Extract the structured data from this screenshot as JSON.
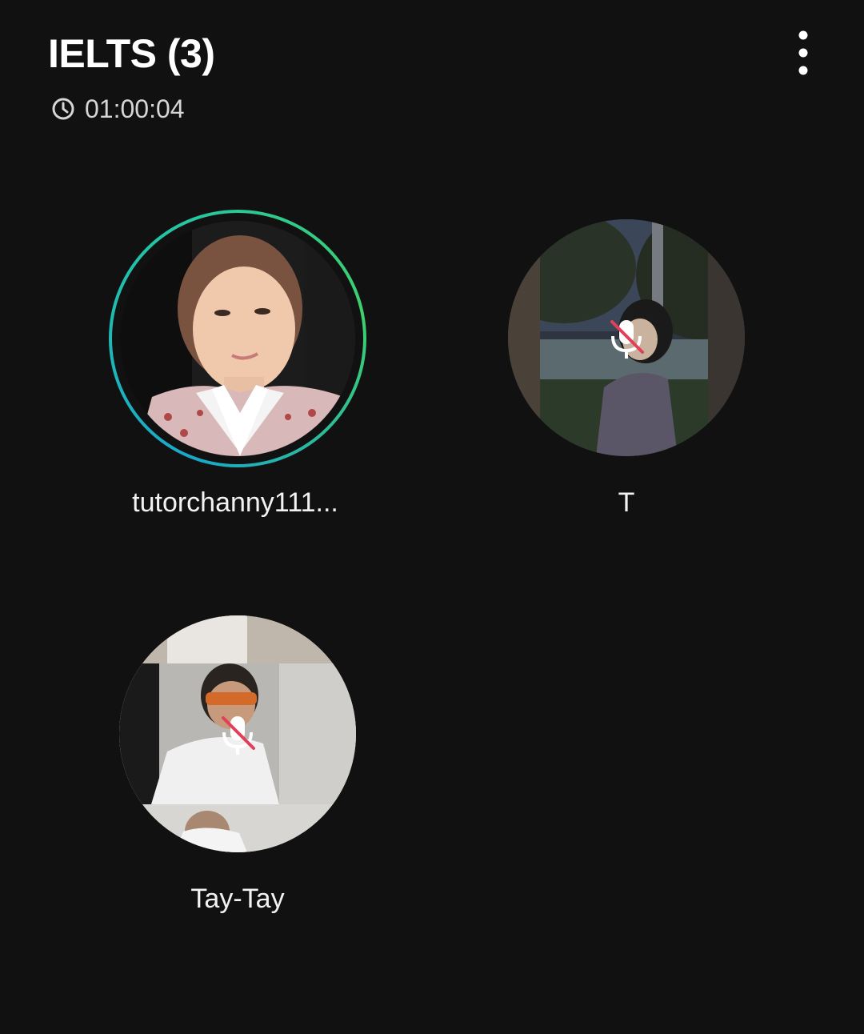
{
  "header": {
    "title": "IELTS (3)",
    "timer": "01:00:04"
  },
  "participants": [
    {
      "name": "tutorchanny111...",
      "speaking": true,
      "muted": false
    },
    {
      "name": "T",
      "speaking": false,
      "muted": true
    },
    {
      "name": "Tay-Tay",
      "speaking": false,
      "muted": true
    }
  ],
  "colors": {
    "background": "#111111",
    "speaking_ring_start": "#1aa7c9",
    "speaking_ring_end": "#3ecf6e",
    "mute_slash": "#e0405a"
  },
  "icons": {
    "timer": "clock-icon",
    "more": "more-vertical-icon",
    "muted": "mic-off-icon"
  }
}
